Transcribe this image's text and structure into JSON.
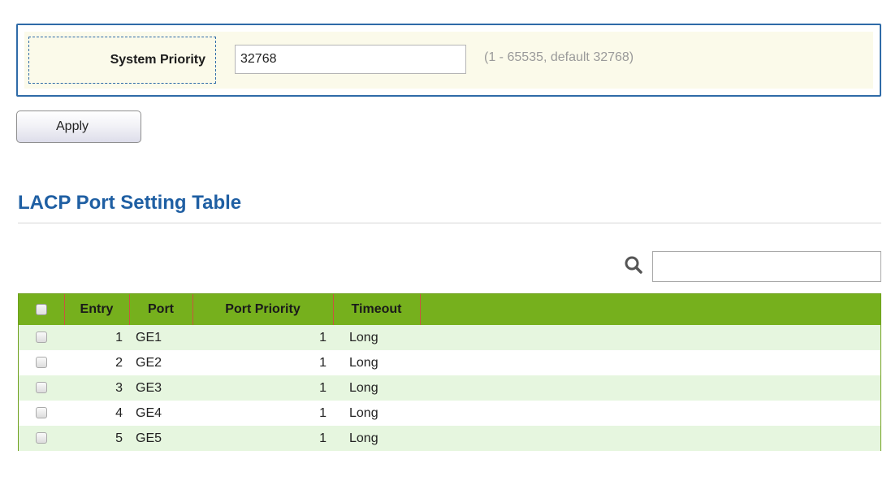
{
  "system_priority": {
    "label": "System Priority",
    "value": "32768",
    "hint": "(1 - 65535, default 32768)"
  },
  "apply_label": "Apply",
  "port_table": {
    "title": "LACP Port Setting Table",
    "search_value": "",
    "columns": [
      "Entry",
      "Port",
      "Port Priority",
      "Timeout"
    ],
    "rows": [
      {
        "entry": "1",
        "port": "GE1",
        "priority": "1",
        "timeout": "Long"
      },
      {
        "entry": "2",
        "port": "GE2",
        "priority": "1",
        "timeout": "Long"
      },
      {
        "entry": "3",
        "port": "GE3",
        "priority": "1",
        "timeout": "Long"
      },
      {
        "entry": "4",
        "port": "GE4",
        "priority": "1",
        "timeout": "Long"
      },
      {
        "entry": "5",
        "port": "GE5",
        "priority": "1",
        "timeout": "Long"
      }
    ]
  },
  "colors": {
    "accent_blue": "#1f5fa3",
    "header_green": "#76b01d",
    "row_stripe": "#e6f6df",
    "panel_bg": "#fbfaea"
  },
  "icons": {
    "search": "search-icon"
  }
}
